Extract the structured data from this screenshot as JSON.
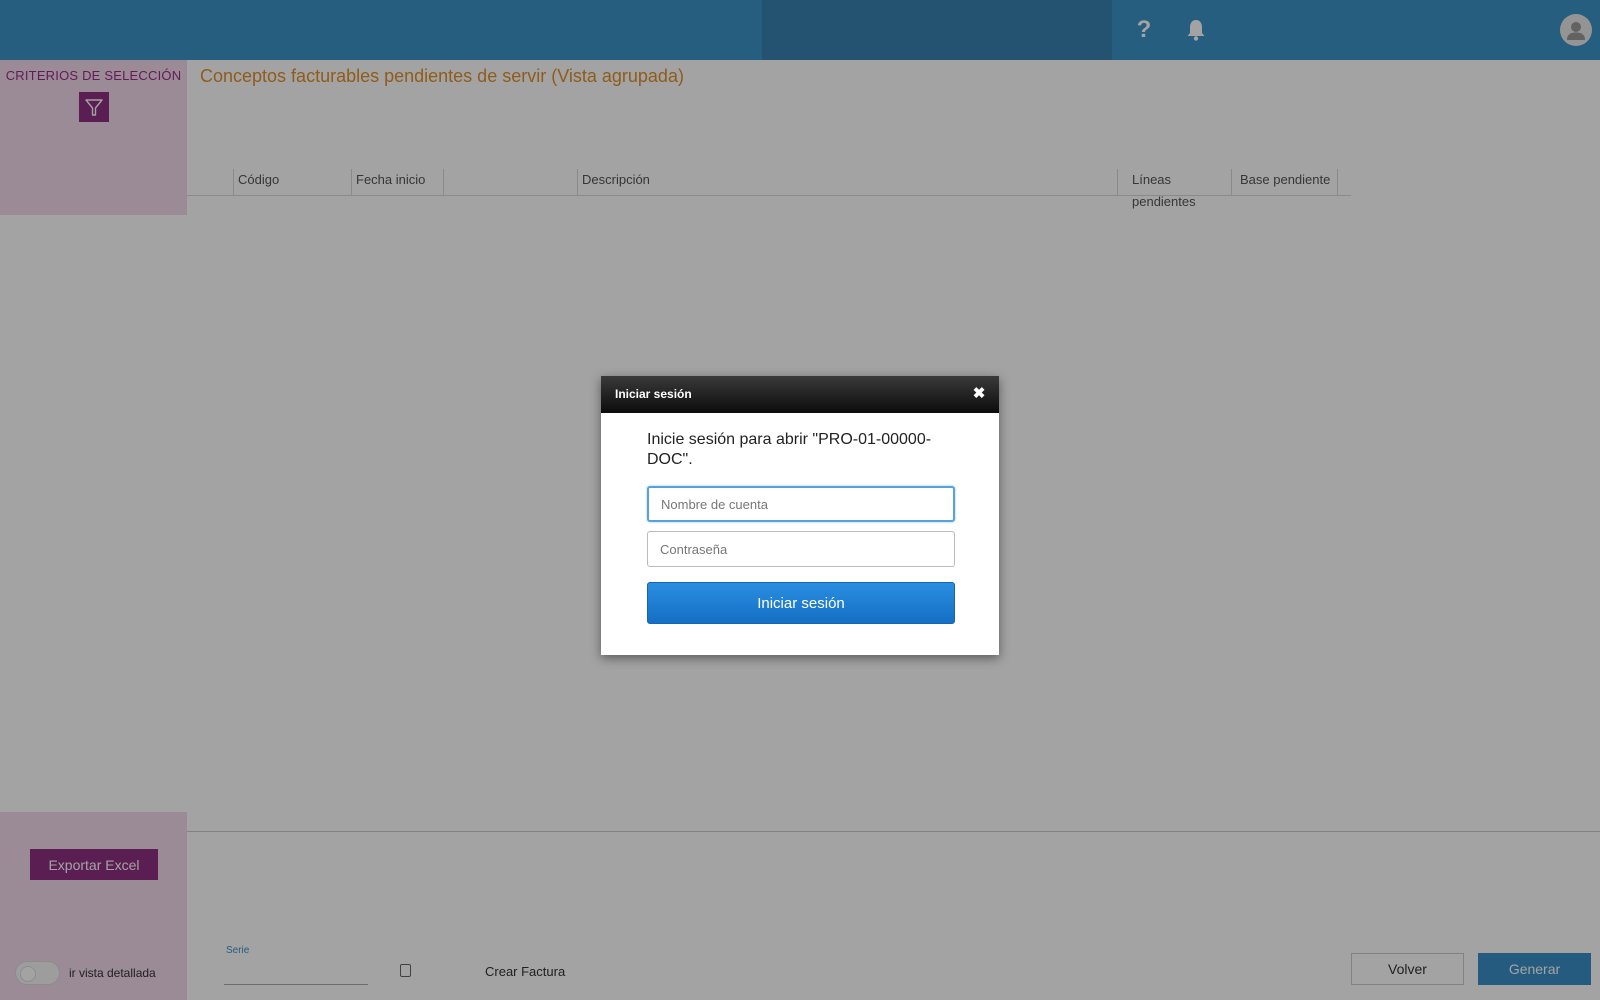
{
  "header": {
    "help_icon": "question-mark",
    "notification_icon": "bell",
    "avatar_icon": "user-silhouette",
    "help_glyph": "?"
  },
  "sidebar": {
    "criteria_label": "CRITERIOS DE SELECCIÓN",
    "filter_icon": "funnel",
    "export_label": "Exportar Excel",
    "toggle_label": "ir vista detallada"
  },
  "main": {
    "title": "Conceptos facturables pendientes de servir (Vista agrupada)",
    "columns": [
      "Código",
      "Fecha inicio",
      "",
      "Descripción",
      "Líneas pendientes",
      "Base pendiente"
    ]
  },
  "footer": {
    "serie_label": "Serie",
    "serie_value": "",
    "crear_factura_label": "Crear Factura",
    "crear_factura_checked": false,
    "volver_label": "Volver",
    "generar_label": "Generar"
  },
  "dialog": {
    "title": "Iniciar sesión",
    "close_glyph": "✖",
    "message": "Inicie sesión para abrir \"PRO-01-00000-DOC\".",
    "username_placeholder": "Nombre de cuenta",
    "password_placeholder": "Contraseña",
    "submit_label": "Iniciar sesión"
  },
  "colors": {
    "topbar": "#3a93c7",
    "accent_purple": "#8e2f83",
    "title_orange": "#e0902c",
    "primary_blue": "#3a8fc6"
  }
}
